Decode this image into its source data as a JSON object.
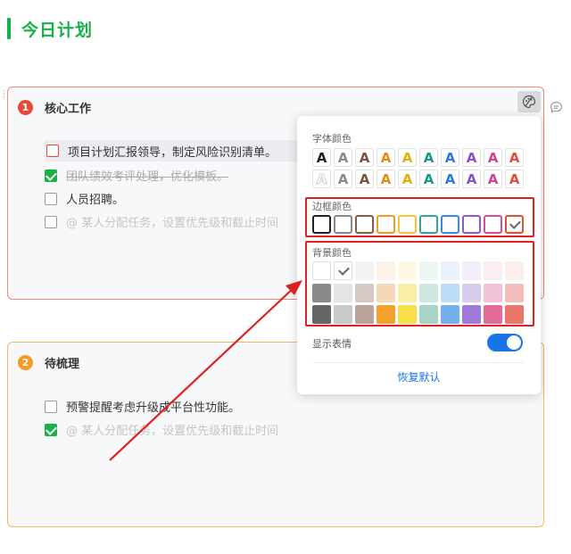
{
  "page": {
    "title": "今日计划"
  },
  "cards": [
    {
      "index": "1",
      "title": "核心工作",
      "tasks": [
        {
          "text": "项目计划汇报领导，制定风险识别清单。",
          "checked": false
        },
        {
          "text": "团队绩效考评处理，优化模板。",
          "checked": true
        },
        {
          "text": "人员招聘。",
          "checked": false
        }
      ],
      "placeholder": "@ 某人分配任务，设置优先级和截止时间"
    },
    {
      "index": "2",
      "title": "待梳理",
      "tasks": [
        {
          "text": "预警提醒考虑升级成平台性功能。",
          "checked": false
        }
      ],
      "placeholder": "@ 某人分配任务，设置优先级和截止时间"
    }
  ],
  "popup": {
    "font_color_label": "字体颜色",
    "font_glyph": "A",
    "font_colors_row1": [
      "#222222",
      "#8a8a8a",
      "#7a5040",
      "#e88a17",
      "#e0b010",
      "#159a8a",
      "#2a7ae2",
      "#8a4fd0",
      "#d4418e",
      "#e0503c"
    ],
    "font_colors_row2": [
      "outline",
      "#8a8a8a",
      "#7a5040",
      "#e88a17",
      "#e0b010",
      "#159a8a",
      "#2a7ae2",
      "#8a4fd0",
      "#d4418e",
      "#e0503c"
    ],
    "border_color_label": "边框颜色",
    "border_colors": [
      "#222222",
      "#8a8a8a",
      "#8a5a4a",
      "#f29a26",
      "#f5c238",
      "#2fa896",
      "#3b8ae8",
      "#9456d6",
      "#d94d98",
      "#e0503c"
    ],
    "bg_color_label": "背景颜色",
    "bg_colors_row1": [
      "#ffffff",
      "#ffffff",
      "#f3f3f3",
      "#fdf2ea",
      "#fdf9e3",
      "#ecf6f3",
      "#eaf3fc",
      "#f3effa",
      "#fbeef3",
      "#fbeeec"
    ],
    "bg_colors_row2": [
      "#8a8a8a",
      "#e4e4e4",
      "#d6c9c4",
      "#f6d7b6",
      "#faf0a5",
      "#cfe7e1",
      "#bcdcf7",
      "#d8cdef",
      "#f2c3d6",
      "#f1bebb"
    ],
    "bg_colors_row3": [
      "#666666",
      "#c9c9c9",
      "#b9a39b",
      "#f3a02e",
      "#f7e14b",
      "#a7d3c8",
      "#74b1ec",
      "#a07ad9",
      "#e26b9c",
      "#ec7368"
    ],
    "show_emoji_label": "显示表情",
    "show_emoji_on": true,
    "reset_label": "恢复默认"
  },
  "colors": {
    "accent_green": "#17b14a",
    "annotation_red": "#e02020",
    "link_blue": "#1a73e8"
  }
}
